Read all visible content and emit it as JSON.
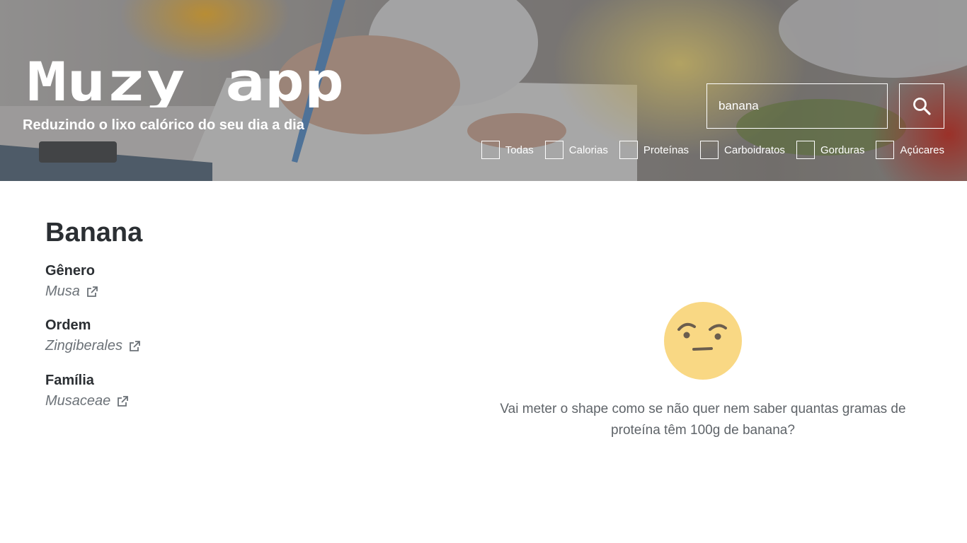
{
  "header": {
    "logo_text": "Muzy app",
    "tagline": "Reduzindo o lixo calórico do seu dia a dia",
    "search": {
      "value": "banana",
      "placeholder": ""
    },
    "search_icon": "search-icon",
    "filters": [
      {
        "label": "Todas",
        "checked": false
      },
      {
        "label": "Calorias",
        "checked": false
      },
      {
        "label": "Proteínas",
        "checked": false
      },
      {
        "label": "Carboidratos",
        "checked": false
      },
      {
        "label": "Gorduras",
        "checked": false
      },
      {
        "label": "Açúcares",
        "checked": false
      }
    ]
  },
  "food": {
    "name": "Banana",
    "taxonomy": [
      {
        "label": "Gênero",
        "value": "Musa",
        "icon": "external-link-icon"
      },
      {
        "label": "Ordem",
        "value": "Zingiberales",
        "icon": "external-link-icon"
      },
      {
        "label": "Família",
        "value": "Musaceae",
        "icon": "external-link-icon"
      }
    ]
  },
  "empty_state": {
    "icon": "thinking-face-icon",
    "message": "Vai meter o shape como se não quer nem saber quantas gramas de proteína têm 100g de banana?"
  },
  "colors": {
    "emoji_face": "#f9d884",
    "emoji_features": "#6b5e4e",
    "text_dark": "#2b2f33",
    "text_muted": "#6c7278"
  }
}
